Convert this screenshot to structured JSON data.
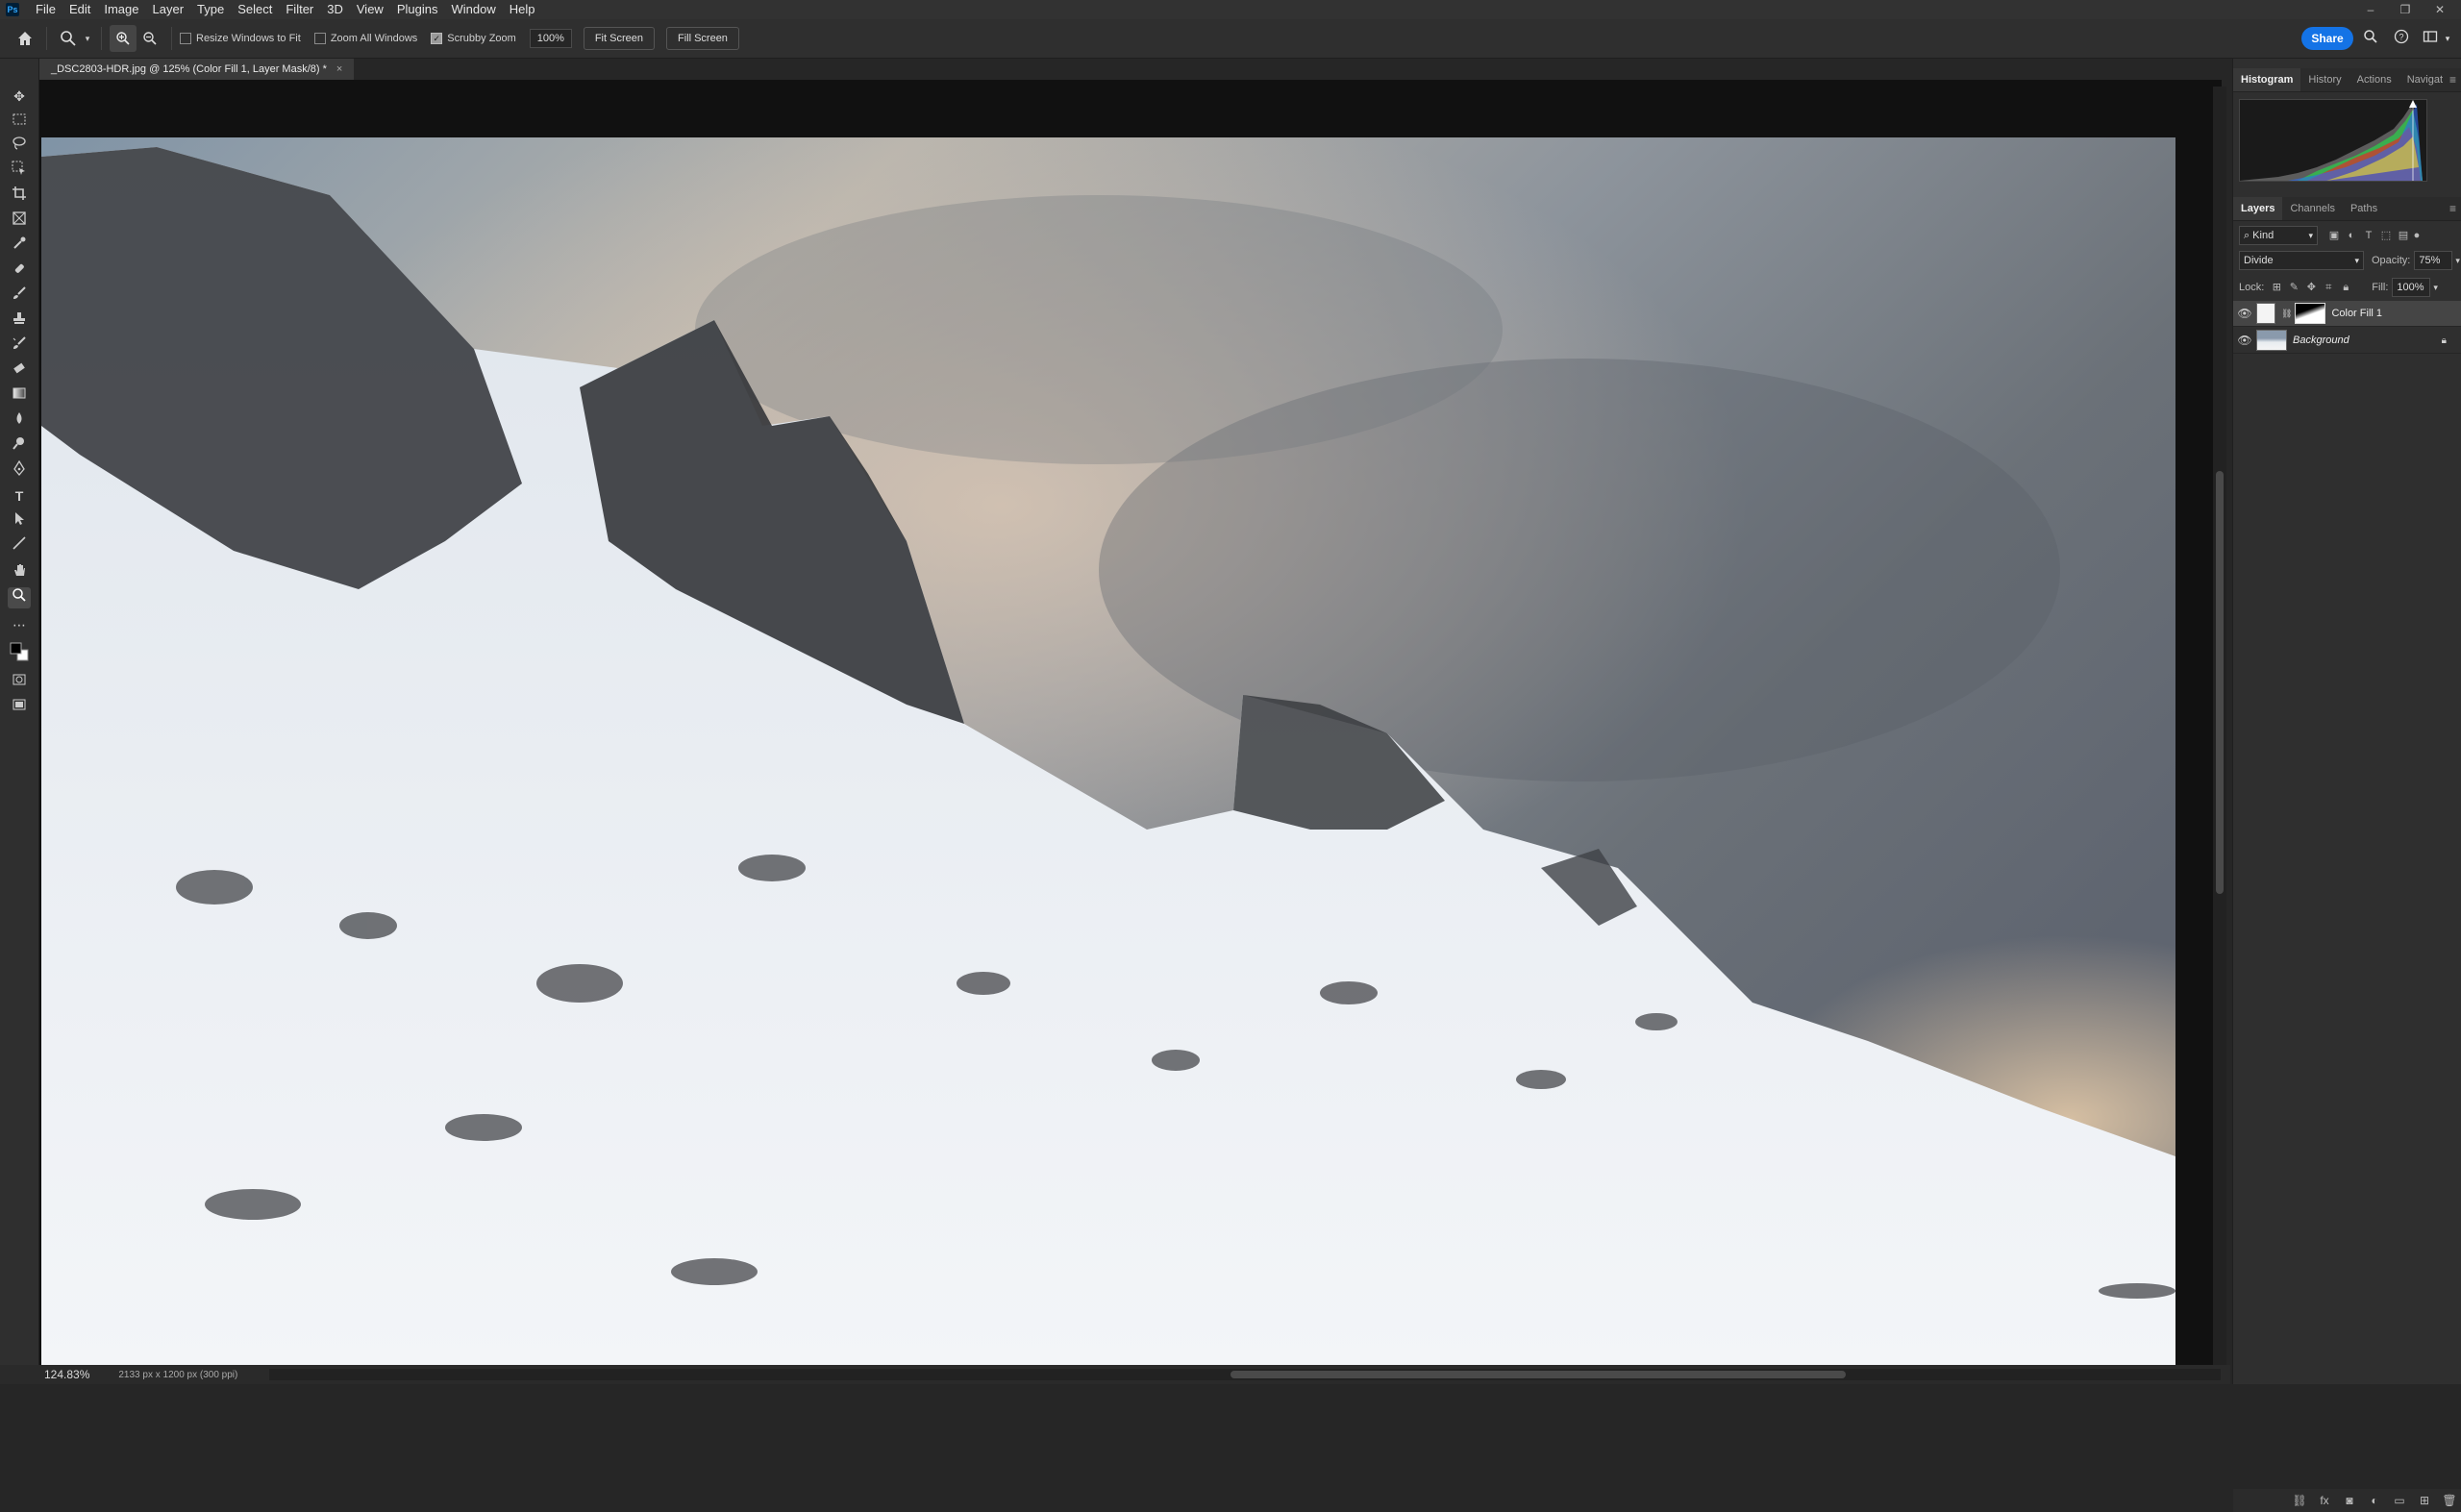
{
  "app": {
    "logo": "Ps"
  },
  "menu": [
    "File",
    "Edit",
    "Image",
    "Layer",
    "Type",
    "Select",
    "Filter",
    "3D",
    "View",
    "Plugins",
    "Window",
    "Help"
  ],
  "window_controls": [
    "–",
    "❐",
    "✕"
  ],
  "options": {
    "resize_windows_label": "Resize Windows to Fit",
    "zoom_all_label": "Zoom All Windows",
    "scrubby_label": "Scrubby Zoom",
    "zoom_value": "100%",
    "fit_screen": "Fit Screen",
    "fill_screen": "Fill Screen",
    "share": "Share",
    "checkbox_states": {
      "resize": false,
      "zoom_all": false,
      "scrubby": true
    }
  },
  "document": {
    "tab_title": "_DSC2803-HDR.jpg @ 125% (Color Fill 1, Layer Mask/8) *",
    "close": "×"
  },
  "status": {
    "zoom": "124.83%",
    "info": "2133 px x 1200 px (300 ppi)",
    "arrow": "›"
  },
  "panels": {
    "top_tabs": [
      "Histogram",
      "History",
      "Actions",
      "Navigat"
    ],
    "layer_tabs": [
      "Layers",
      "Channels",
      "Paths"
    ],
    "filter_kind": "Kind",
    "blend_mode": "Divide",
    "opacity_label": "Opacity:",
    "opacity_value": "75%",
    "lock_label": "Lock:",
    "fill_label": "Fill:",
    "fill_value": "100%",
    "layers": [
      {
        "name": "Color Fill 1",
        "selected": true
      },
      {
        "name": "Background",
        "selected": false
      }
    ]
  },
  "colors": {
    "accent": "#1473e6",
    "panel_bg": "#2f2f2f",
    "canvas_bg": "#111111"
  }
}
